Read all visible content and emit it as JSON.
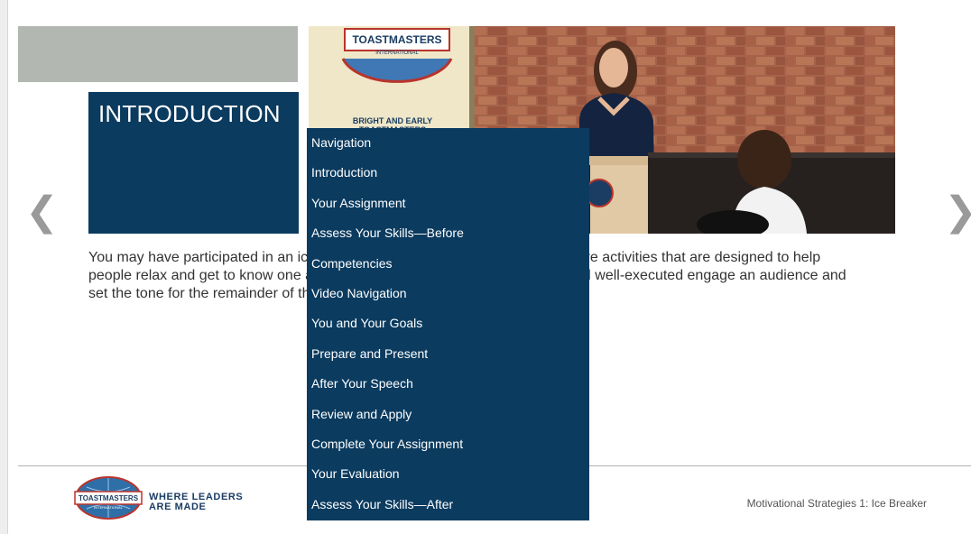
{
  "slide": {
    "heading": "INTRODUCTION",
    "body": "You may have participated in an icebreaker at some point in your life. These are activities that are designed to help people relax and get to know one another. Activities that are well-designed and well-executed engage an audience and set the tone for the remainder of the event.",
    "prev_arrow": "❮",
    "next_arrow": "❯"
  },
  "hero_image": {
    "banner_brand": "TOASTMASTERS",
    "banner_sub": "INTERNATIONAL",
    "banner_caption_1": "BRIGHT AND EARLY",
    "banner_caption_2": "TOASTMASTERS",
    "lectern_logo": "TOASTMASTERS"
  },
  "nav_menu": {
    "items": [
      {
        "label": "Navigation"
      },
      {
        "label": "Introduction"
      },
      {
        "label": "Your Assignment"
      },
      {
        "label": "Assess Your Skills—Before"
      },
      {
        "label": "Competencies"
      },
      {
        "label": "Video Navigation"
      },
      {
        "label": "You and Your Goals"
      },
      {
        "label": "Prepare and Present"
      },
      {
        "label": "After Your Speech"
      },
      {
        "label": "Review and Apply"
      },
      {
        "label": "Complete Your Assignment"
      },
      {
        "label": "Your Evaluation"
      },
      {
        "label": "Assess Your Skills—After"
      }
    ]
  },
  "footer": {
    "logo_text": "TOASTMASTERS",
    "logo_sub": "INTERNATIONAL",
    "tagline_line1": "WHERE LEADERS",
    "tagline_line2": "ARE MADE",
    "course_title": "Motivational Strategies 1: Ice Breaker"
  },
  "colors": {
    "navy": "#0b3b5f",
    "gray_band": "#b2b7b2",
    "brick": "#9a5a44",
    "gold": "#c9a23c"
  }
}
